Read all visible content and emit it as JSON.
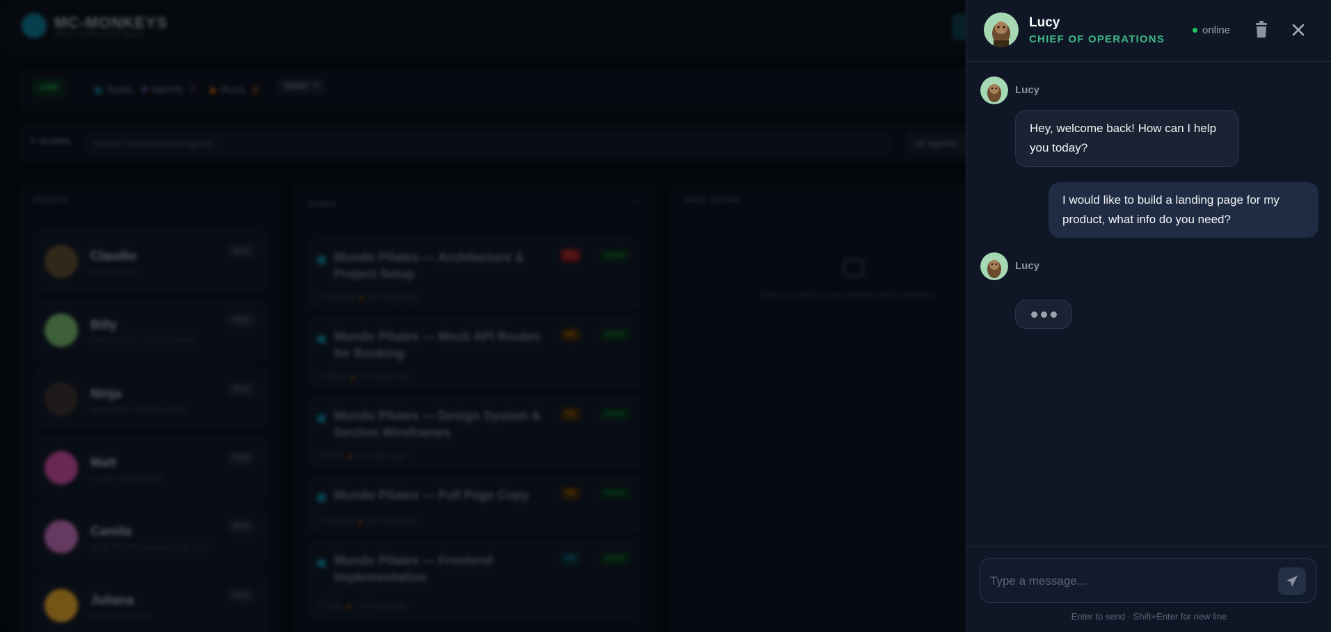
{
  "app": {
    "brand": "MC-MONKEYS",
    "brand_sub": "Mission Control for AI Agents"
  },
  "statusbar": {
    "live": "LIVE",
    "tasks_label": "Tasks",
    "tasks_count": "7",
    "agents_label": "Agents",
    "agents_count": "7",
    "runs_label": "Runs",
    "runs_count": "2",
    "version": "DEMO · 7"
  },
  "filters": {
    "label": "FILTERS",
    "search_placeholder": "Search tasks/activity/agents...",
    "agent_select": "All agents"
  },
  "agents_panel": {
    "title": "AGENTS",
    "items": [
      {
        "name": "Claudio",
        "role": "TECH LEAD",
        "status": "IDLE",
        "color": "#5b4a30"
      },
      {
        "name": "Billy",
        "role": "FRONTEND DEVELOPER",
        "status": "IDLE",
        "color": "#6fae6a"
      },
      {
        "name": "Ninja",
        "role": "BACKEND DEVELOPER",
        "status": "IDLE",
        "color": "#3a3030"
      },
      {
        "name": "Matt",
        "role": "UI/UX DESIGNER",
        "status": "IDLE",
        "color": "#c04a9a"
      },
      {
        "name": "Camila",
        "role": "WEB PERFORMANCE & SEO",
        "status": "IDLE",
        "color": "#b86ab0"
      },
      {
        "name": "Juliana",
        "role": "COPYWRITER",
        "status": "IDLE",
        "color": "#d49b2a"
      }
    ]
  },
  "tasks_panel": {
    "title": "TASKS",
    "count": "6/7",
    "items": [
      {
        "title": "Mundo Pilates — Architecture & Project Setup",
        "priority": "P1",
        "pcolor": "#7f1d1d",
        "ptext": "#ef4444",
        "status": "DONE",
        "assignee": "Claudio",
        "age": "5 days ago"
      },
      {
        "title": "Mundo Pilates — Mock API Routes for Booking",
        "priority": "P2",
        "pcolor": "#3a2a0c",
        "ptext": "#d97706",
        "status": "DONE",
        "assignee": "Ninja",
        "age": "5 days ago"
      },
      {
        "title": "Mundo Pilates — Design System & Section Wireframes",
        "priority": "P2",
        "pcolor": "#3a2a0c",
        "ptext": "#d97706",
        "status": "DONE",
        "assignee": "Matt",
        "age": "5 days ago"
      },
      {
        "title": "Mundo Pilates — Full Page Copy",
        "priority": "P2",
        "pcolor": "#3a2a0c",
        "ptext": "#d97706",
        "status": "DONE",
        "assignee": "Juliana",
        "age": "5 days ago"
      },
      {
        "title": "Mundo Pilates — Frontend Implementation",
        "priority": "P3",
        "pcolor": "#0c2d3a",
        "ptext": "#0891b2",
        "status": "DONE",
        "assignee": "Billy",
        "age": "5 days ago"
      }
    ]
  },
  "detail_panel": {
    "title": "TASK DETAIL",
    "empty": "Select a task to see details and subtasks"
  },
  "chat": {
    "agent_name": "Lucy",
    "agent_role": "CHIEF OF OPERATIONS",
    "status": "online",
    "messages": [
      {
        "sender": "Lucy",
        "text": "Hey, welcome back! How can I help you today?"
      },
      {
        "sender": "user",
        "text": "I would like to build a landing page for my product, what info do you need?"
      },
      {
        "sender": "Lucy",
        "typing": true
      }
    ],
    "input_placeholder": "Type a message...",
    "hint": "Enter to send · Shift+Enter for new line"
  }
}
